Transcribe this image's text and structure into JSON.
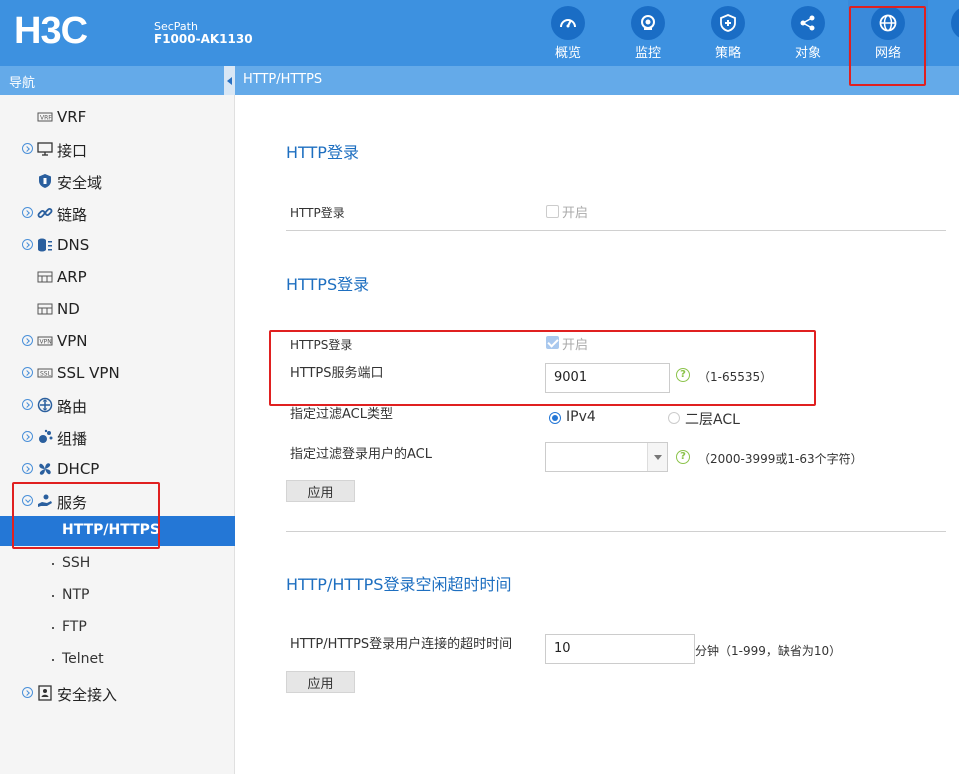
{
  "brand": {
    "logo_text": "H3C",
    "product_line1": "SecPath",
    "product_line2": "F1000-AK1130"
  },
  "topnav": [
    {
      "label": "概览",
      "icon": "gauge-icon"
    },
    {
      "label": "监控",
      "icon": "camera-icon"
    },
    {
      "label": "策略",
      "icon": "shield-plus-icon"
    },
    {
      "label": "对象",
      "icon": "share-icon"
    },
    {
      "label": "网络",
      "icon": "globe-icon",
      "active": true
    }
  ],
  "subbar": {
    "nav_title": "导航",
    "breadcrumb": "HTTP/HTTPS"
  },
  "sidebar": {
    "items": [
      {
        "label": "VRF"
      },
      {
        "label": "接口"
      },
      {
        "label": "安全域"
      },
      {
        "label": "链路"
      },
      {
        "label": "DNS"
      },
      {
        "label": "ARP"
      },
      {
        "label": "ND"
      },
      {
        "label": "VPN"
      },
      {
        "label": "SSL VPN"
      },
      {
        "label": "路由"
      },
      {
        "label": "组播"
      },
      {
        "label": "DHCP"
      },
      {
        "label": "服务"
      }
    ],
    "service_children": [
      {
        "label": "HTTP/HTTPS",
        "active": true
      },
      {
        "label": "SSH"
      },
      {
        "label": "NTP"
      },
      {
        "label": "FTP"
      },
      {
        "label": "Telnet"
      }
    ],
    "last_item": {
      "label": "安全接入"
    }
  },
  "http_section": {
    "title": "HTTP登录",
    "login_label": "HTTP登录",
    "enable_label": "开启",
    "enabled": false
  },
  "https_section": {
    "title": "HTTPS登录",
    "login_label": "HTTPS登录",
    "enable_label": "开启",
    "enabled": true,
    "port_label": "HTTPS服务端口",
    "port_value": "9001",
    "port_hint": "（1-65535）",
    "acl_type_label": "指定过滤ACL类型",
    "acl_type_options": [
      "IPv4",
      "二层ACL"
    ],
    "acl_type_selected": "IPv4",
    "acl_label": "指定过滤登录用户的ACL",
    "acl_value": "",
    "acl_hint": "（2000-3999或1-63个字符）",
    "apply_label": "应用",
    "help_glyph": "?"
  },
  "timeout_section": {
    "title": "HTTP/HTTPS登录空闲超时时间",
    "timeout_label": "HTTP/HTTPS登录用户连接的超时时间",
    "timeout_value": "10",
    "timeout_hint": "分钟（1-999，缺省为10）",
    "apply_label": "应用"
  },
  "colors": {
    "header": "#3d91e0",
    "subbar": "#64aae9",
    "accent": "#2477d6",
    "section_title": "#1e6fc0",
    "highlight_box": "#e02020"
  }
}
